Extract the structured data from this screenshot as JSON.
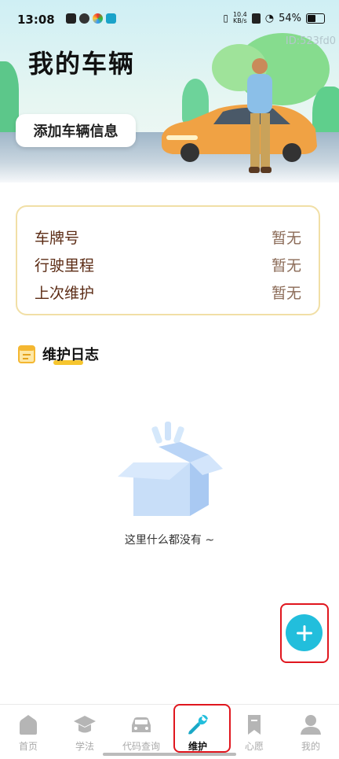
{
  "status_bar": {
    "time": "13:08",
    "net_speed_value": "10.4",
    "net_speed_unit": "KB/s",
    "battery": "54%"
  },
  "header": {
    "title": "我的车辆",
    "id_tag": "ID:523fd0",
    "add_info_button": "添加车辆信息"
  },
  "vehicle_info": {
    "rows": [
      {
        "label": "车牌号",
        "value": "暂无"
      },
      {
        "label": "行驶里程",
        "value": "暂无"
      },
      {
        "label": "上次维护",
        "value": "暂无"
      }
    ]
  },
  "maintenance_log": {
    "title": "维护日志",
    "empty_text": "这里什么都没有 ~"
  },
  "tabbar": {
    "tabs": [
      {
        "label": "首页",
        "icon": "home-icon"
      },
      {
        "label": "学法",
        "icon": "graduation-cap-icon"
      },
      {
        "label": "代码查询",
        "icon": "car-icon"
      },
      {
        "label": "维护",
        "icon": "wrench-icon"
      },
      {
        "label": "心愿",
        "icon": "bookmark-icon"
      },
      {
        "label": "我的",
        "icon": "user-icon"
      }
    ],
    "active_tab": "维护"
  },
  "colors": {
    "accent": "#22bedc",
    "highlight_frame": "#e0161e",
    "card_border": "#f1dfa6",
    "label_brown": "#5b2b14"
  }
}
